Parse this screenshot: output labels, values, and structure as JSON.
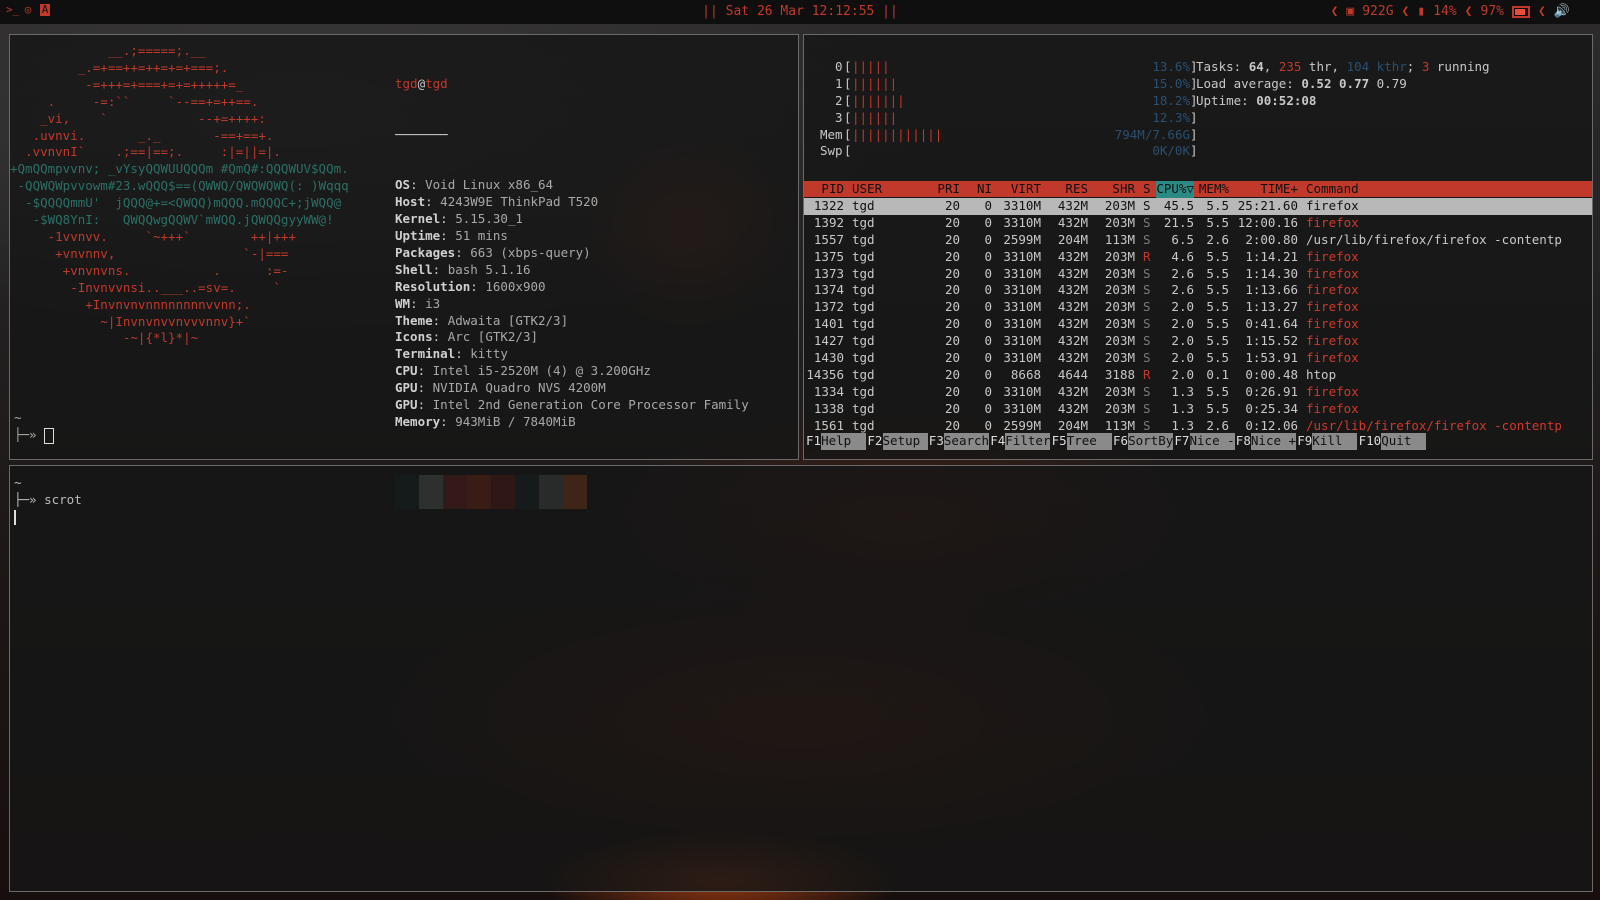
{
  "topbar": {
    "clock": "|| Sat 26 Mar 12:12:55 ||",
    "disk": "922G",
    "cpu": "14%",
    "battery": "97%",
    "left_icons": [
      "terminal-icon",
      "browser-icon",
      "app-icon"
    ],
    "right_icons": [
      "disk-icon",
      "memory-icon",
      "battery-icon",
      "volume-icon"
    ]
  },
  "neofetch": {
    "userhost_user": "tgd",
    "userhost_at": "@",
    "userhost_host": "tgd",
    "underline": "───────",
    "logo_lines": [
      "             __.;=====;.__",
      "         _.=+==++=++=+=+===;.",
      "          -=+++=+===+=+=+++++=_",
      "     .     -=:``     `--==+=++==.",
      "    _vi,    `            --+=++++:",
      "   .uvnvi.       _._       -==+==+.",
      "  .vvnvnI`    .;==|==;.     :|=||=|.",
      "+QmQQmpvvnv; _vYsyQQWUUQQQm #QmQ#:QQQWUV$QQm.",
      " -QQWQWpvvowm#23.wQQQ$==(QWWQ/QWQWQWQ(: )Wqqq",
      "  -$QQQQmmU'  jQQQ@+=<QWQQ)mQQQ.mQQQC+;jWQQ@",
      "   -$WQ8YnI:   QWQQwgQQWV`mWQQ.jQWQQgyyWW@!",
      "     -1vvnvv.     `~+++`        ++|+++",
      "      +vnvnnv,                 `-|===",
      "       +vnvnvns.           .      :=-",
      "        -Invnvvnsi..___..=sv=.     `",
      "          +Invnvnvnnnnnnnnvvnn;.",
      "            ~|Invnvnvvnvvvnnv}+`",
      "               -~|{*l}*|~"
    ],
    "fields": [
      {
        "key": "OS",
        "value": "Void Linux x86_64"
      },
      {
        "key": "Host",
        "value": "4243W9E ThinkPad T520"
      },
      {
        "key": "Kernel",
        "value": "5.15.30_1"
      },
      {
        "key": "Uptime",
        "value": "51 mins"
      },
      {
        "key": "Packages",
        "value": "663 (xbps-query)"
      },
      {
        "key": "Shell",
        "value": "bash 5.1.16"
      },
      {
        "key": "Resolution",
        "value": "1600x900"
      },
      {
        "key": "WM",
        "value": "i3"
      },
      {
        "key": "Theme",
        "value": "Adwaita [GTK2/3]"
      },
      {
        "key": "Icons",
        "value": "Arc [GTK2/3]"
      },
      {
        "key": "Terminal",
        "value": "kitty"
      },
      {
        "key": "CPU",
        "value": "Intel i5-2520M (4) @ 3.200GHz"
      },
      {
        "key": "GPU",
        "value": "NVIDIA Quadro NVS 4200M"
      },
      {
        "key": "GPU",
        "value": "Intel 2nd Generation Core Processor Family"
      },
      {
        "key": "Memory",
        "value": "943MiB / 7840MiB"
      }
    ],
    "swatches": [
      "#15302e",
      "#9aa0a0",
      "#b52a1e",
      "#d63b13",
      "#9c1c14",
      "#15302e",
      "#7f8a8a",
      "#f26b1d"
    ],
    "prompt_tilde": "~",
    "prompt_arrow": "├─» "
  },
  "htop": {
    "cpus": [
      {
        "label": "0",
        "bars": "|||||",
        "value": "13.6%"
      },
      {
        "label": "1",
        "bars": "||||||",
        "value": "15.0%"
      },
      {
        "label": "2",
        "bars": "|||||||",
        "value": "18.2%"
      },
      {
        "label": "3",
        "bars": "||||||",
        "value": "12.3%"
      }
    ],
    "mem": {
      "label": "Mem",
      "bars": "||||||||||||",
      "value": "794M/7.66G"
    },
    "swp": {
      "label": "Swp",
      "bars": "",
      "value": "0K/0K"
    },
    "tasks": {
      "label": "Tasks:",
      "tasks": "64",
      "thr": "235",
      "thr_label": "thr",
      "kthr": "104 kthr",
      "running": "3",
      "running_label": "running"
    },
    "load": {
      "label": "Load average:",
      "v1": "0.52",
      "v5": "0.77",
      "v15": "0.79"
    },
    "uptime": {
      "label": "Uptime:",
      "value": "00:52:08"
    },
    "columns": [
      "PID",
      "USER",
      "PRI",
      "NI",
      "VIRT",
      "RES",
      "SHR",
      "S",
      "CPU%▽",
      "MEM%",
      "TIME+",
      "Command"
    ],
    "processes": [
      {
        "pid": "1322",
        "user": "tgd",
        "pri": "20",
        "ni": "0",
        "virt": "3310M",
        "res": "432M",
        "shr": "203M",
        "s": "S",
        "cpu": "45.5",
        "mem": "5.5",
        "time": "25:21.60",
        "cmd": "firefox"
      },
      {
        "pid": "1392",
        "user": "tgd",
        "pri": "20",
        "ni": "0",
        "virt": "3310M",
        "res": "432M",
        "shr": "203M",
        "s": "S",
        "cpu": "21.5",
        "mem": "5.5",
        "time": "12:00.16",
        "cmd": "firefox"
      },
      {
        "pid": "1557",
        "user": "tgd",
        "pri": "20",
        "ni": "0",
        "virt": "2599M",
        "res": "204M",
        "shr": "113M",
        "s": "S",
        "cpu": "6.5",
        "mem": "2.6",
        "time": "2:00.80",
        "cmd": "/usr/lib/firefox/firefox -contentp"
      },
      {
        "pid": "1375",
        "user": "tgd",
        "pri": "20",
        "ni": "0",
        "virt": "3310M",
        "res": "432M",
        "shr": "203M",
        "s": "R",
        "cpu": "4.6",
        "mem": "5.5",
        "time": "1:14.21",
        "cmd": "firefox"
      },
      {
        "pid": "1373",
        "user": "tgd",
        "pri": "20",
        "ni": "0",
        "virt": "3310M",
        "res": "432M",
        "shr": "203M",
        "s": "S",
        "cpu": "2.6",
        "mem": "5.5",
        "time": "1:14.30",
        "cmd": "firefox"
      },
      {
        "pid": "1374",
        "user": "tgd",
        "pri": "20",
        "ni": "0",
        "virt": "3310M",
        "res": "432M",
        "shr": "203M",
        "s": "S",
        "cpu": "2.6",
        "mem": "5.5",
        "time": "1:13.66",
        "cmd": "firefox"
      },
      {
        "pid": "1372",
        "user": "tgd",
        "pri": "20",
        "ni": "0",
        "virt": "3310M",
        "res": "432M",
        "shr": "203M",
        "s": "S",
        "cpu": "2.0",
        "mem": "5.5",
        "time": "1:13.27",
        "cmd": "firefox"
      },
      {
        "pid": "1401",
        "user": "tgd",
        "pri": "20",
        "ni": "0",
        "virt": "3310M",
        "res": "432M",
        "shr": "203M",
        "s": "S",
        "cpu": "2.0",
        "mem": "5.5",
        "time": "0:41.64",
        "cmd": "firefox"
      },
      {
        "pid": "1427",
        "user": "tgd",
        "pri": "20",
        "ni": "0",
        "virt": "3310M",
        "res": "432M",
        "shr": "203M",
        "s": "S",
        "cpu": "2.0",
        "mem": "5.5",
        "time": "1:15.52",
        "cmd": "firefox"
      },
      {
        "pid": "1430",
        "user": "tgd",
        "pri": "20",
        "ni": "0",
        "virt": "3310M",
        "res": "432M",
        "shr": "203M",
        "s": "S",
        "cpu": "2.0",
        "mem": "5.5",
        "time": "1:53.91",
        "cmd": "firefox"
      },
      {
        "pid": "14356",
        "user": "tgd",
        "pri": "20",
        "ni": "0",
        "virt": "8668",
        "res": "4644",
        "shr": "3188",
        "s": "R",
        "cpu": "2.0",
        "mem": "0.1",
        "time": "0:00.48",
        "cmd": "htop"
      },
      {
        "pid": "1334",
        "user": "tgd",
        "pri": "20",
        "ni": "0",
        "virt": "3310M",
        "res": "432M",
        "shr": "203M",
        "s": "S",
        "cpu": "1.3",
        "mem": "5.5",
        "time": "0:26.91",
        "cmd": "firefox"
      },
      {
        "pid": "1338",
        "user": "tgd",
        "pri": "20",
        "ni": "0",
        "virt": "3310M",
        "res": "432M",
        "shr": "203M",
        "s": "S",
        "cpu": "1.3",
        "mem": "5.5",
        "time": "0:25.34",
        "cmd": "firefox"
      },
      {
        "pid": "1561",
        "user": "tgd",
        "pri": "20",
        "ni": "0",
        "virt": "2599M",
        "res": "204M",
        "shr": "113M",
        "s": "S",
        "cpu": "1.3",
        "mem": "2.6",
        "time": "0:12.06",
        "cmd": "/usr/lib/firefox/firefox -contentp"
      }
    ],
    "fkeys": [
      {
        "key": "F1",
        "label": "Help  "
      },
      {
        "key": "F2",
        "label": "Setup "
      },
      {
        "key": "F3",
        "label": "Search"
      },
      {
        "key": "F4",
        "label": "Filter"
      },
      {
        "key": "F5",
        "label": "Tree  "
      },
      {
        "key": "F6",
        "label": "SortBy"
      },
      {
        "key": "F7",
        "label": "Nice -"
      },
      {
        "key": "F8",
        "label": "Nice +"
      },
      {
        "key": "F9",
        "label": "Kill  "
      },
      {
        "key": "F10",
        "label": "Quit  "
      }
    ]
  },
  "terminal": {
    "tilde": "~",
    "prompt": "├─» ",
    "command": "scrot"
  }
}
